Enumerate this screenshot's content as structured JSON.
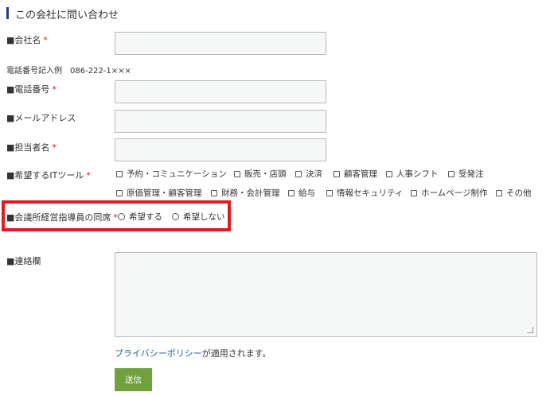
{
  "header": {
    "title": "この会社に問い合わせ"
  },
  "fields": {
    "company": {
      "label": "■会社名",
      "required": "*",
      "value": ""
    },
    "phone_example": "電話番号記入例　086-222-1×××",
    "phone": {
      "label": "■電話番号",
      "required": "*",
      "value": ""
    },
    "email": {
      "label": "■メールアドレス",
      "value": ""
    },
    "person": {
      "label": "■担当者名",
      "required": "*",
      "value": ""
    },
    "tools": {
      "label": "■希望するITツール",
      "required": "*",
      "row1": [
        "予約・コミュニケーション",
        "販売・店頭",
        "決済",
        "顧客管理",
        "人事シフト",
        "受発注"
      ],
      "row2": [
        "原価管理・顧客管理",
        "財務・会計管理",
        "給与",
        "情報セキュリティ",
        "ホームページ制作",
        "その他"
      ]
    },
    "attendance": {
      "label": "■会議所経営指導員の同席",
      "required": "*",
      "options": [
        "希望する",
        "希望しない"
      ]
    },
    "message": {
      "label": "■連絡欄",
      "value": ""
    }
  },
  "privacy": {
    "link": "プライバシーポリシー",
    "suffix": "が適用されます。"
  },
  "submit": {
    "label": "送信"
  },
  "colors": {
    "accent": "#6fa13c",
    "highlight": "#e01a22",
    "link": "#1f5fa8",
    "required": "#e0141e"
  }
}
